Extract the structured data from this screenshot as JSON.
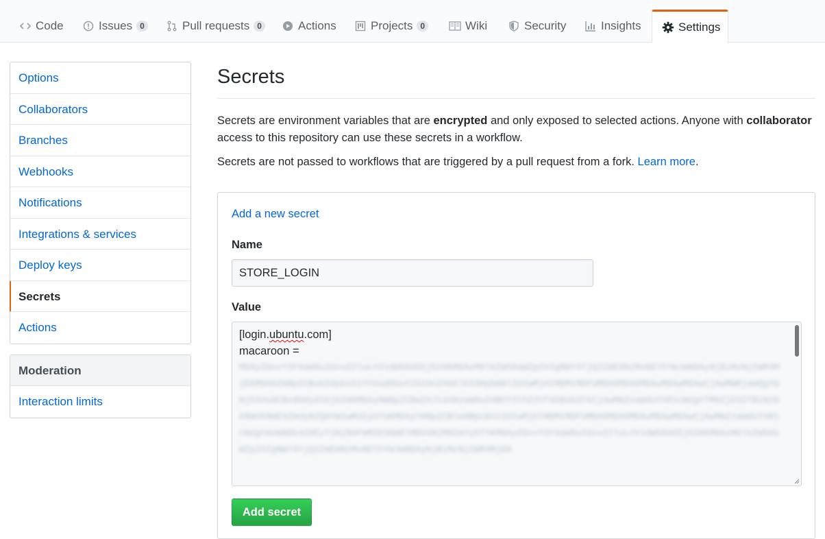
{
  "tabs": [
    {
      "label": "Code",
      "icon": "code-icon"
    },
    {
      "label": "Issues",
      "icon": "issue-opened-icon",
      "count": "0"
    },
    {
      "label": "Pull requests",
      "icon": "git-pull-request-icon",
      "count": "0"
    },
    {
      "label": "Actions",
      "icon": "play-icon"
    },
    {
      "label": "Projects",
      "icon": "project-icon",
      "count": "0"
    },
    {
      "label": "Wiki",
      "icon": "book-icon"
    },
    {
      "label": "Security",
      "icon": "shield-icon"
    },
    {
      "label": "Insights",
      "icon": "graph-icon"
    },
    {
      "label": "Settings",
      "icon": "gear-icon",
      "selected": true
    }
  ],
  "sidebar": {
    "items": [
      {
        "label": "Options"
      },
      {
        "label": "Collaborators"
      },
      {
        "label": "Branches"
      },
      {
        "label": "Webhooks"
      },
      {
        "label": "Notifications"
      },
      {
        "label": "Integrations & services"
      },
      {
        "label": "Deploy keys"
      },
      {
        "label": "Secrets",
        "selected": true
      },
      {
        "label": "Actions"
      }
    ],
    "moderation": {
      "heading": "Moderation",
      "items": [
        {
          "label": "Interaction limits"
        }
      ]
    }
  },
  "main": {
    "title": "Secrets",
    "desc_part1": "Secrets are environment variables that are ",
    "desc_bold1": "encrypted",
    "desc_part2": " and only exposed to selected actions. Anyone with ",
    "desc_bold2": "collaborator",
    "desc_part3": " access to this repository can use these secrets in a workflow.",
    "desc2": "Secrets are not passed to workflows that are triggered by a pull request from a fork. ",
    "learn_more": "Learn more",
    "desc2_end": "."
  },
  "form": {
    "add_link": "Add a new secret",
    "name_label": "Name",
    "name_value": "STORE_LOGIN",
    "value_label": "Value",
    "value_line1_a": "[login.",
    "value_line1_b": "ubuntu",
    "value_line1_c": ".com]",
    "value_line2": "macaroon =",
    "submit": "Add secret"
  },
  "colors": {
    "accent": "#e36209",
    "link": "#0366d6",
    "button": "#28a745"
  }
}
